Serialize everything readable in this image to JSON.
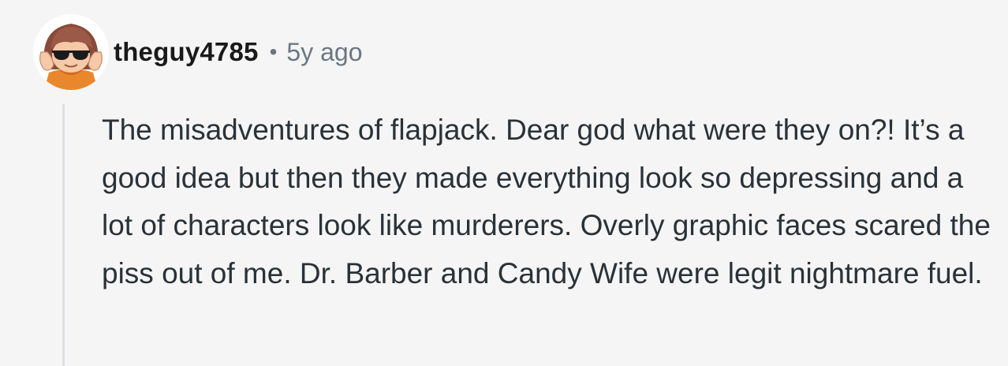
{
  "comment": {
    "avatar_icon": "cartoon-avatar-sunglasses",
    "username": "theguy4785",
    "separator": "•",
    "timestamp": "5y ago",
    "body": "The misadventures of flapjack. Dear god what were they on?! It’s a good idea but then they made everything look so depressing and a lot of characters look like murderers. Overly graphic faces scared the piss out of me. Dr. Barber and Candy Wife were legit nightmare fuel."
  },
  "colors": {
    "background": "#f5f5f5",
    "username": "#1a1a1b",
    "meta": "#6a7783",
    "body_text": "#2a3238",
    "thread_line": "#dce1e6"
  }
}
